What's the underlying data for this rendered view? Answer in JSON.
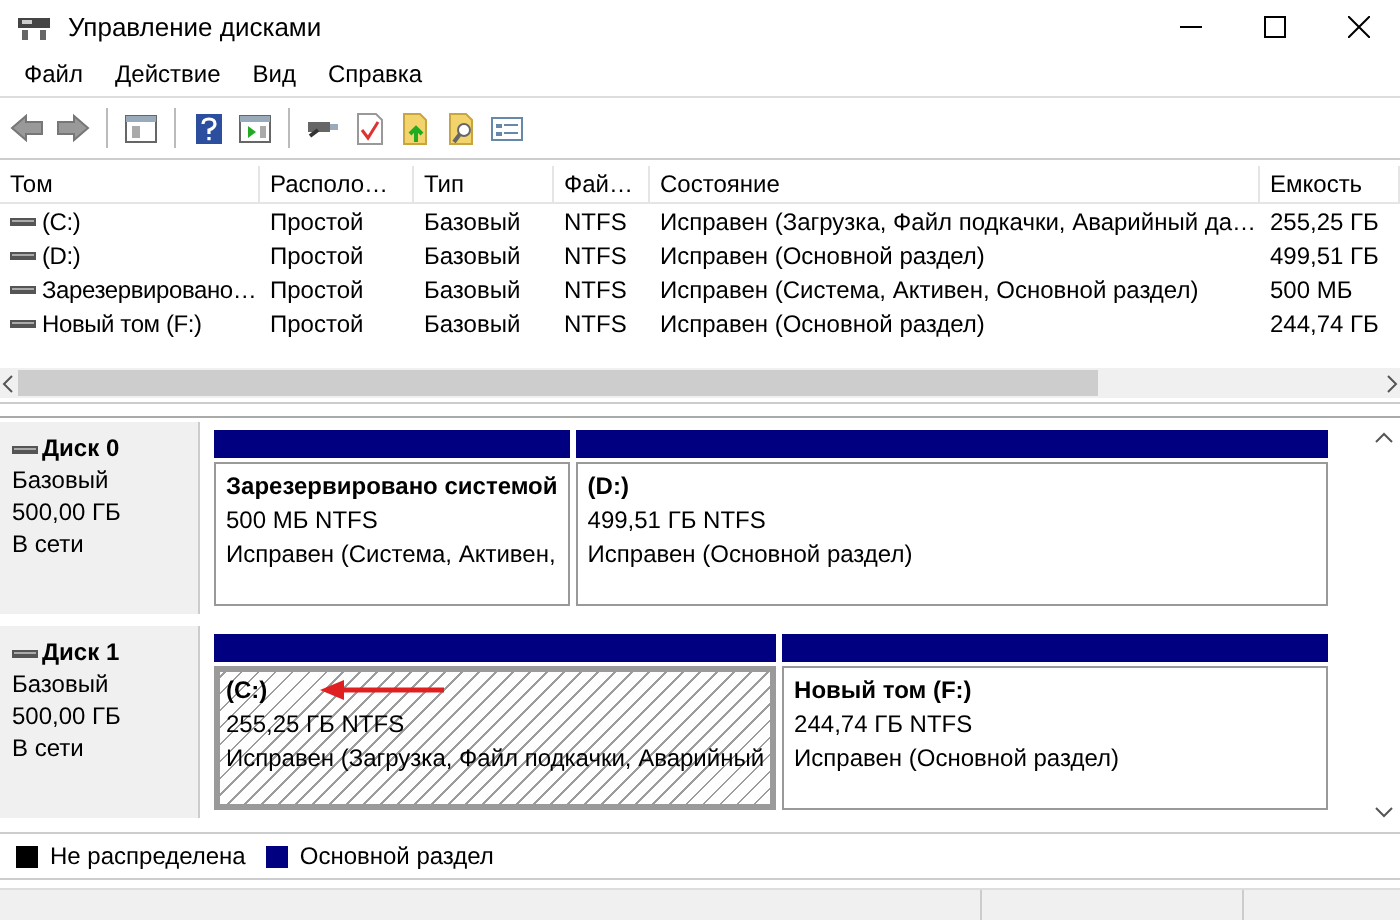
{
  "window": {
    "title": "Управление дисками"
  },
  "menu": [
    "Файл",
    "Действие",
    "Вид",
    "Справка"
  ],
  "volume_table": {
    "columns": [
      "Том",
      "Располо…",
      "Тип",
      "Фай…",
      "Состояние",
      "Емкость"
    ],
    "rows": [
      {
        "cells": [
          "(C:)",
          "Простой",
          "Базовый",
          "NTFS",
          "Исправен (Загрузка, Файл подкачки, Аварийный да…",
          "255,25 ГБ"
        ]
      },
      {
        "cells": [
          "(D:)",
          "Простой",
          "Базовый",
          "NTFS",
          "Исправен (Основной раздел)",
          "499,51 ГБ"
        ]
      },
      {
        "cells": [
          "Зарезервировано…",
          "Простой",
          "Базовый",
          "NTFS",
          "Исправен (Система, Активен, Основной раздел)",
          "500 МБ"
        ]
      },
      {
        "cells": [
          "Новый том (F:)",
          "Простой",
          "Базовый",
          "NTFS",
          "Исправен (Основной раздел)",
          "244,74 ГБ"
        ]
      }
    ]
  },
  "disks": [
    {
      "name": "Диск 0",
      "type": "Базовый",
      "size": "500,00 ГБ",
      "status": "В сети",
      "partitions": [
        {
          "name": "Зарезервировано системой",
          "size": "500 МБ NTFS",
          "status": "Исправен (Система, Активен,",
          "selected": false,
          "marked": false
        },
        {
          "name": "(D:)",
          "size": "499,51 ГБ NTFS",
          "status": "Исправен (Основной раздел)",
          "selected": false,
          "marked": false
        }
      ]
    },
    {
      "name": "Диск 1",
      "type": "Базовый",
      "size": "500,00 ГБ",
      "status": "В сети",
      "partitions": [
        {
          "name": "(C:)",
          "size": "255,25 ГБ NTFS",
          "status": "Исправен (Загрузка, Файл подкачки, Аварийный",
          "selected": true,
          "marked": true
        },
        {
          "name": "Новый том  (F:)",
          "size": "244,74 ГБ NTFS",
          "status": "Исправен (Основной раздел)",
          "selected": false,
          "marked": false
        }
      ]
    }
  ],
  "legend": [
    {
      "label": "Не распределена",
      "color": "#000000"
    },
    {
      "label": "Основной раздел",
      "color": "#000080"
    }
  ]
}
